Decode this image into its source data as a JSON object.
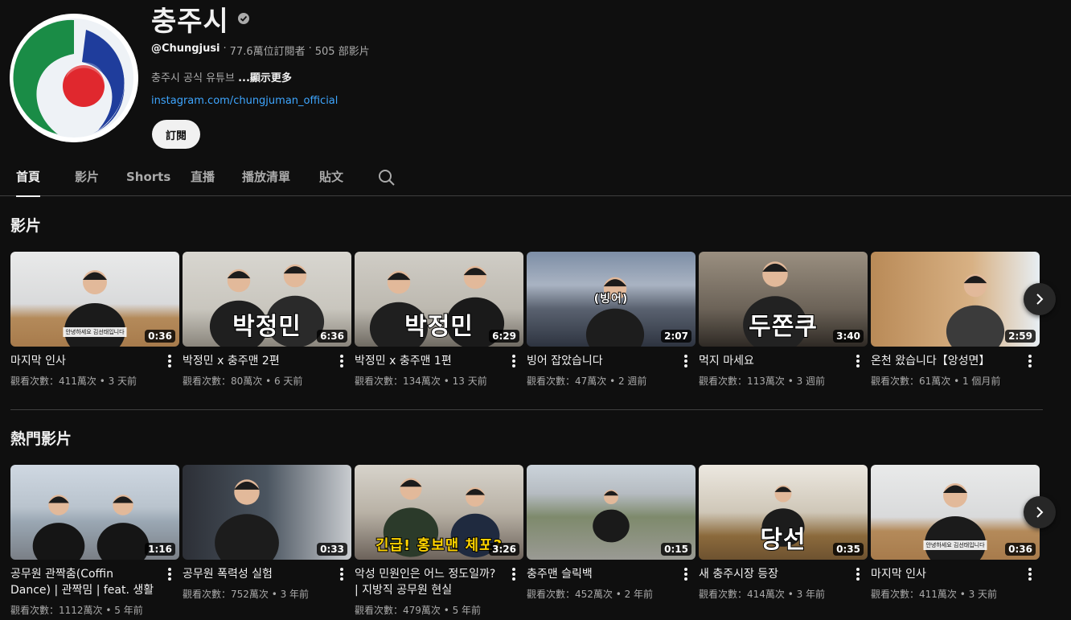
{
  "channel": {
    "name": "충주시",
    "handle": "@Chungjusi",
    "subscribers": "77.6萬位訂閱者",
    "video_count": "505 部影片",
    "separator": "‧",
    "description": "충주시 공식 유튜브",
    "more_label": "...顯示更多",
    "link": "instagram.com/chungjuman_official",
    "subscribe_label": "訂閱"
  },
  "tabs": [
    "首頁",
    "影片",
    "Shorts",
    "直播",
    "播放清單",
    "貼文"
  ],
  "sections": {
    "videos_title": "影片",
    "popular_title": "熱門影片"
  },
  "videos": [
    {
      "title": "마지막 인사",
      "meta": "觀看次數：411萬次 • 3 天前",
      "duration": "0:36",
      "overlay": "",
      "subcap": "안녕하세요 김선태입니다"
    },
    {
      "title": "박정민 x 충주맨 2편",
      "meta": "觀看次數：80萬次 • 6 天前",
      "duration": "6:36",
      "overlay": "박정민",
      "subcap": ""
    },
    {
      "title": "박정민 x 충주맨 1편",
      "meta": "觀看次數：134萬次 • 13 天前",
      "duration": "6:29",
      "overlay": "박정민",
      "subcap": ""
    },
    {
      "title": "빙어 잡았습니다",
      "meta": "觀看次數：47萬次 • 2 週前",
      "duration": "2:07",
      "overlay": "(빙어)",
      "subcap": ""
    },
    {
      "title": "먹지 마세요",
      "meta": "觀看次數：113萬次 • 3 週前",
      "duration": "3:40",
      "overlay": "두쫀쿠",
      "subcap": ""
    },
    {
      "title": "온천 왔습니다【앙성면】",
      "meta": "觀看次數：61萬次 • 1 個月前",
      "duration": "2:59",
      "overlay": "",
      "subcap": ""
    }
  ],
  "popular": [
    {
      "title": "공무원 관짝춤(Coffin Dance) | 관짝밈 | feat. 생활 속 거...",
      "meta": "觀看次數：1112萬次 • 5 年前",
      "duration": "1:16",
      "overlay": "",
      "subcap": ""
    },
    {
      "title": "공무원 폭력성 실험",
      "meta": "觀看次數：752萬次 • 3 年前",
      "duration": "0:33",
      "overlay": "",
      "subcap": ""
    },
    {
      "title": "악성 민원인은 어느 정도일까? | 지방직 공무원 현실",
      "meta": "觀看次數：479萬次 • 5 年前",
      "duration": "3:26",
      "overlay": "긴급! 홍보맨 체포?",
      "subcap": ""
    },
    {
      "title": "충주맨 슬릭백",
      "meta": "觀看次數：452萬次 • 2 年前",
      "duration": "0:15",
      "overlay": "",
      "subcap": ""
    },
    {
      "title": "새 충주시장 등장",
      "meta": "觀看次數：414萬次 • 3 年前",
      "duration": "0:35",
      "overlay": "당선",
      "subcap": ""
    },
    {
      "title": "마지막 인사",
      "meta": "觀看次數：411萬次 • 3 天前",
      "duration": "0:36",
      "overlay": "",
      "subcap": "안녕하세요 김선태입니다"
    }
  ]
}
